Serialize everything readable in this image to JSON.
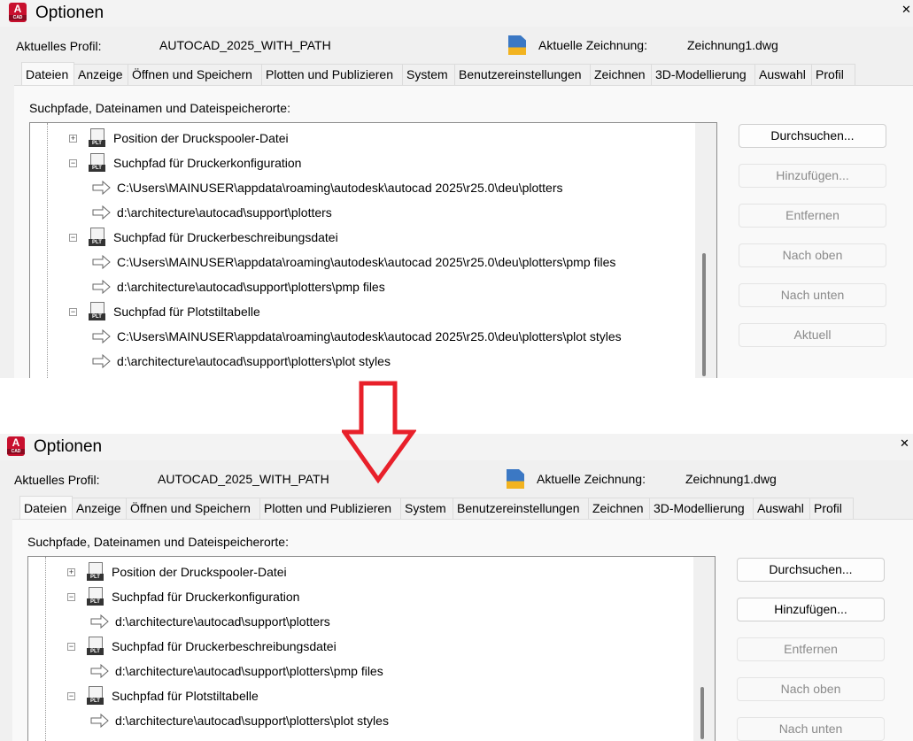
{
  "colors": {
    "arrow": "#e8202a",
    "app_icon": "#c8102e"
  },
  "panels": [
    {
      "title": "Optionen",
      "app_icon_text": "A",
      "app_icon_sub": "CAD",
      "close": "✕",
      "profile_label": "Aktuelles Profil:",
      "profile_value": "AUTOCAD_2025_WITH_PATH",
      "drawing_label": "Aktuelle Zeichnung:",
      "drawing_value": "Zeichnung1.dwg",
      "tabs": [
        "Dateien",
        "Anzeige",
        "Öffnen und Speichern",
        "Plotten und Publizieren",
        "System",
        "Benutzereinstellungen",
        "Zeichnen",
        "3D-Modellierung",
        "Auswahl",
        "Profil"
      ],
      "active_tab": 0,
      "section_label": "Suchpfade, Dateinamen und Dateispeicherorte:",
      "tree": [
        {
          "level": 1,
          "expander": "+",
          "text": "Position der Druckspooler-Datei"
        },
        {
          "level": 1,
          "expander": "−",
          "text": "Suchpfad für Druckerkonfiguration"
        },
        {
          "level": 2,
          "text": "C:\\Users\\MAINUSER\\appdata\\roaming\\autodesk\\autocad 2025\\r25.0\\deu\\plotters"
        },
        {
          "level": 2,
          "text": "d:\\architecture\\autocad\\support\\plotters"
        },
        {
          "level": 1,
          "expander": "−",
          "text": "Suchpfad für Druckerbeschreibungsdatei"
        },
        {
          "level": 2,
          "text": "C:\\Users\\MAINUSER\\appdata\\roaming\\autodesk\\autocad 2025\\r25.0\\deu\\plotters\\pmp files"
        },
        {
          "level": 2,
          "text": "d:\\architecture\\autocad\\support\\plotters\\pmp files"
        },
        {
          "level": 1,
          "expander": "−",
          "text": "Suchpfad für Plotstiltabelle"
        },
        {
          "level": 2,
          "text": "C:\\Users\\MAINUSER\\appdata\\roaming\\autodesk\\autocad 2025\\r25.0\\deu\\plotters\\plot styles"
        },
        {
          "level": 2,
          "text": "d:\\architecture\\autocad\\support\\plotters\\plot styles"
        }
      ],
      "buttons": [
        {
          "label": "Durchsuchen...",
          "enabled": true
        },
        {
          "label": "Hinzufügen...",
          "enabled": false
        },
        {
          "label": "Entfernen",
          "enabled": false
        },
        {
          "label": "Nach oben",
          "enabled": false
        },
        {
          "label": "Nach unten",
          "enabled": false
        },
        {
          "label": "Aktuell",
          "enabled": false
        }
      ]
    },
    {
      "title": "Optionen",
      "app_icon_text": "A",
      "app_icon_sub": "CAD",
      "close": "✕",
      "profile_label": "Aktuelles Profil:",
      "profile_value": "AUTOCAD_2025_WITH_PATH",
      "drawing_label": "Aktuelle Zeichnung:",
      "drawing_value": "Zeichnung1.dwg",
      "tabs": [
        "Dateien",
        "Anzeige",
        "Öffnen und Speichern",
        "Plotten und Publizieren",
        "System",
        "Benutzereinstellungen",
        "Zeichnen",
        "3D-Modellierung",
        "Auswahl",
        "Profil"
      ],
      "active_tab": 0,
      "section_label": "Suchpfade, Dateinamen und Dateispeicherorte:",
      "tree": [
        {
          "level": 1,
          "expander": "+",
          "text": "Position der Druckspooler-Datei"
        },
        {
          "level": 1,
          "expander": "−",
          "text": "Suchpfad für Druckerkonfiguration"
        },
        {
          "level": 2,
          "text": "d:\\architecture\\autocad\\support\\plotters"
        },
        {
          "level": 1,
          "expander": "−",
          "text": "Suchpfad für Druckerbeschreibungsdatei"
        },
        {
          "level": 2,
          "text": "d:\\architecture\\autocad\\support\\plotters\\pmp files"
        },
        {
          "level": 1,
          "expander": "−",
          "text": "Suchpfad für Plotstiltabelle"
        },
        {
          "level": 2,
          "text": "d:\\architecture\\autocad\\support\\plotters\\plot styles"
        }
      ],
      "buttons": [
        {
          "label": "Durchsuchen...",
          "enabled": true
        },
        {
          "label": "Hinzufügen...",
          "enabled": true
        },
        {
          "label": "Entfernen",
          "enabled": false
        },
        {
          "label": "Nach oben",
          "enabled": false
        },
        {
          "label": "Nach unten",
          "enabled": false
        }
      ]
    }
  ]
}
